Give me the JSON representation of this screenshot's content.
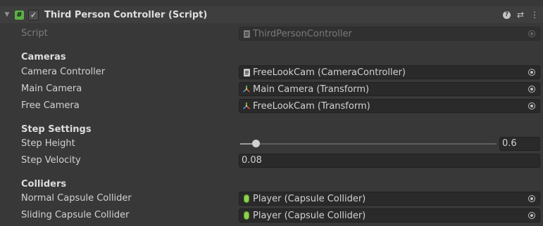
{
  "component": {
    "title": "Third Person Controller (Script)",
    "enabled": true,
    "expanded": true
  },
  "script_field": {
    "label": "Script",
    "value": "ThirdPersonController"
  },
  "sections": {
    "cameras": "Cameras",
    "step_settings": "Step Settings",
    "colliders": "Colliders"
  },
  "cameras": {
    "camera_controller": {
      "label": "Camera Controller",
      "value": "FreeLookCam (CameraController)"
    },
    "main_camera": {
      "label": "Main Camera",
      "value": "Main Camera (Transform)"
    },
    "free_camera": {
      "label": "Free Camera",
      "value": "FreeLookCam (Transform)"
    }
  },
  "step_settings": {
    "step_height": {
      "label": "Step Height",
      "value": "0.6",
      "fraction": 0.06
    },
    "step_velocity": {
      "label": "Step Velocity",
      "value": "0.08"
    }
  },
  "colliders": {
    "normal_capsule": {
      "label": "Normal Capsule Collider",
      "value": "Player (Capsule Collider)"
    },
    "sliding_capsule": {
      "label": "Sliding Capsule Collider",
      "value": "Player (Capsule Collider)"
    }
  },
  "colors": {
    "background": "#383838",
    "header": "#3e3e3e",
    "field": "#2a2a2a",
    "script_icon": "#5bb244",
    "collider_icon": "#8fd14f"
  },
  "icons": {
    "fold": "triangle-down-icon",
    "script": "script-hash-icon",
    "help": "help-icon",
    "preset": "preset-sliders-icon",
    "menu": "kebab-menu-icon",
    "picker": "object-picker-icon",
    "transform": "transform-axes-icon",
    "collider": "capsule-collider-icon"
  }
}
